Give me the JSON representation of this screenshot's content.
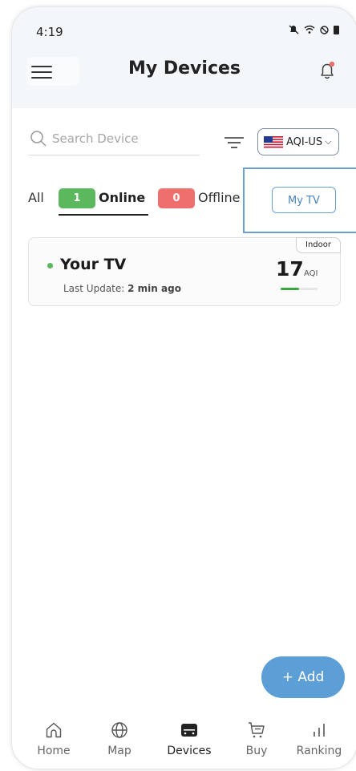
{
  "status": {
    "time": "4:19"
  },
  "header": {
    "title": "My Devices"
  },
  "search": {
    "placeholder": "Search Device"
  },
  "region": {
    "label": "AQI-US"
  },
  "tabs": {
    "all": "All",
    "online_count": "1",
    "online_label": "Online",
    "offline_count": "0",
    "offline_label": "Offline",
    "my_tv": "My TV"
  },
  "devices": [
    {
      "tag": "Indoor",
      "name": "Your TV",
      "status": "online",
      "update_prefix": "Last Update:",
      "update_time": "2 min ago",
      "aqi": "17",
      "aqi_unit": "AQI",
      "aqi_level_fraction": 0.5
    }
  ],
  "add_button": "+ Add",
  "nav": [
    {
      "label": "Home",
      "icon": "home-icon"
    },
    {
      "label": "Map",
      "icon": "globe-icon"
    },
    {
      "label": "Devices",
      "icon": "devices-icon",
      "active": true
    },
    {
      "label": "Buy",
      "icon": "cart-icon"
    },
    {
      "label": "Ranking",
      "icon": "ranking-icon"
    }
  ],
  "colors": {
    "online": "#5cb85c",
    "offline": "#ef6f6c",
    "accent": "#5b9fd6",
    "aqi_good": "#3aaa3a"
  }
}
